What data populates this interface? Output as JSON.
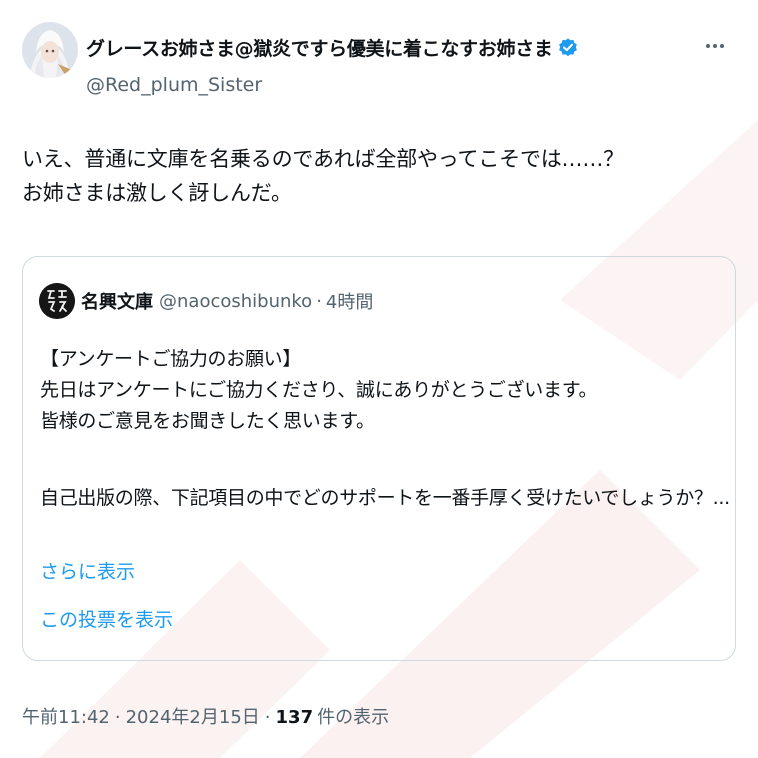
{
  "tweet": {
    "display_name": "グレースお姉さま@獄炎ですら優美に着こなすお姉さま",
    "handle": "@Red_plum_Sister",
    "avatar_icon": "user-avatar-icon",
    "verified_icon": "verified-badge-icon",
    "verified_color": "#1d9bf0",
    "more_icon": "more-options-icon",
    "body_lines": [
      "いえ、普通に文庫を名乗るのであれば全部やってこそでは……？",
      "お姉さまは激しく訝しんだ。"
    ],
    "timestamp": "午前11:42",
    "date": "2024年2月15日",
    "view_count": "137",
    "view_label": "件の表示",
    "separator": "·"
  },
  "quote": {
    "display_name": "名興文庫",
    "handle": "@naocoshibunko",
    "separator": "·",
    "relative_time": "4時間",
    "avatar_icon": "naocoshibunko-logo-icon",
    "lines": [
      "【アンケートご協力のお願い】",
      "先日はアンケートにご協力くださり、誠にありがとうございます。",
      "皆様のご意見をお聞きしたく思います。",
      "自己出版の際、下記項目の中でどのサポートを一番手厚く受けたいでしょうか？..."
    ],
    "show_more": "さらに表示",
    "show_poll": "この投票を表示",
    "link_color": "#1d9bf0"
  }
}
